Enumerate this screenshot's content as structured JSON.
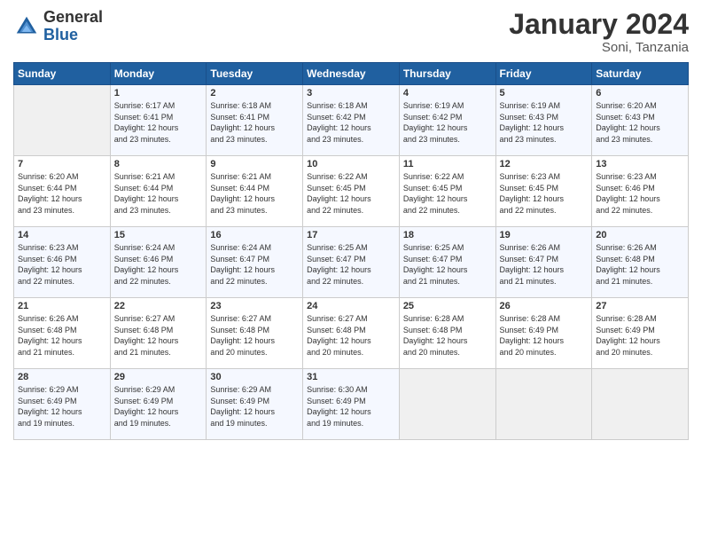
{
  "header": {
    "logo_line1": "General",
    "logo_line2": "Blue",
    "month": "January 2024",
    "location": "Soni, Tanzania"
  },
  "weekdays": [
    "Sunday",
    "Monday",
    "Tuesday",
    "Wednesday",
    "Thursday",
    "Friday",
    "Saturday"
  ],
  "weeks": [
    [
      {
        "day": "",
        "info": ""
      },
      {
        "day": "1",
        "info": "Sunrise: 6:17 AM\nSunset: 6:41 PM\nDaylight: 12 hours\nand 23 minutes."
      },
      {
        "day": "2",
        "info": "Sunrise: 6:18 AM\nSunset: 6:41 PM\nDaylight: 12 hours\nand 23 minutes."
      },
      {
        "day": "3",
        "info": "Sunrise: 6:18 AM\nSunset: 6:42 PM\nDaylight: 12 hours\nand 23 minutes."
      },
      {
        "day": "4",
        "info": "Sunrise: 6:19 AM\nSunset: 6:42 PM\nDaylight: 12 hours\nand 23 minutes."
      },
      {
        "day": "5",
        "info": "Sunrise: 6:19 AM\nSunset: 6:43 PM\nDaylight: 12 hours\nand 23 minutes."
      },
      {
        "day": "6",
        "info": "Sunrise: 6:20 AM\nSunset: 6:43 PM\nDaylight: 12 hours\nand 23 minutes."
      }
    ],
    [
      {
        "day": "7",
        "info": "Sunrise: 6:20 AM\nSunset: 6:44 PM\nDaylight: 12 hours\nand 23 minutes."
      },
      {
        "day": "8",
        "info": "Sunrise: 6:21 AM\nSunset: 6:44 PM\nDaylight: 12 hours\nand 23 minutes."
      },
      {
        "day": "9",
        "info": "Sunrise: 6:21 AM\nSunset: 6:44 PM\nDaylight: 12 hours\nand 23 minutes."
      },
      {
        "day": "10",
        "info": "Sunrise: 6:22 AM\nSunset: 6:45 PM\nDaylight: 12 hours\nand 22 minutes."
      },
      {
        "day": "11",
        "info": "Sunrise: 6:22 AM\nSunset: 6:45 PM\nDaylight: 12 hours\nand 22 minutes."
      },
      {
        "day": "12",
        "info": "Sunrise: 6:23 AM\nSunset: 6:45 PM\nDaylight: 12 hours\nand 22 minutes."
      },
      {
        "day": "13",
        "info": "Sunrise: 6:23 AM\nSunset: 6:46 PM\nDaylight: 12 hours\nand 22 minutes."
      }
    ],
    [
      {
        "day": "14",
        "info": "Sunrise: 6:23 AM\nSunset: 6:46 PM\nDaylight: 12 hours\nand 22 minutes."
      },
      {
        "day": "15",
        "info": "Sunrise: 6:24 AM\nSunset: 6:46 PM\nDaylight: 12 hours\nand 22 minutes."
      },
      {
        "day": "16",
        "info": "Sunrise: 6:24 AM\nSunset: 6:47 PM\nDaylight: 12 hours\nand 22 minutes."
      },
      {
        "day": "17",
        "info": "Sunrise: 6:25 AM\nSunset: 6:47 PM\nDaylight: 12 hours\nand 22 minutes."
      },
      {
        "day": "18",
        "info": "Sunrise: 6:25 AM\nSunset: 6:47 PM\nDaylight: 12 hours\nand 21 minutes."
      },
      {
        "day": "19",
        "info": "Sunrise: 6:26 AM\nSunset: 6:47 PM\nDaylight: 12 hours\nand 21 minutes."
      },
      {
        "day": "20",
        "info": "Sunrise: 6:26 AM\nSunset: 6:48 PM\nDaylight: 12 hours\nand 21 minutes."
      }
    ],
    [
      {
        "day": "21",
        "info": "Sunrise: 6:26 AM\nSunset: 6:48 PM\nDaylight: 12 hours\nand 21 minutes."
      },
      {
        "day": "22",
        "info": "Sunrise: 6:27 AM\nSunset: 6:48 PM\nDaylight: 12 hours\nand 21 minutes."
      },
      {
        "day": "23",
        "info": "Sunrise: 6:27 AM\nSunset: 6:48 PM\nDaylight: 12 hours\nand 20 minutes."
      },
      {
        "day": "24",
        "info": "Sunrise: 6:27 AM\nSunset: 6:48 PM\nDaylight: 12 hours\nand 20 minutes."
      },
      {
        "day": "25",
        "info": "Sunrise: 6:28 AM\nSunset: 6:48 PM\nDaylight: 12 hours\nand 20 minutes."
      },
      {
        "day": "26",
        "info": "Sunrise: 6:28 AM\nSunset: 6:49 PM\nDaylight: 12 hours\nand 20 minutes."
      },
      {
        "day": "27",
        "info": "Sunrise: 6:28 AM\nSunset: 6:49 PM\nDaylight: 12 hours\nand 20 minutes."
      }
    ],
    [
      {
        "day": "28",
        "info": "Sunrise: 6:29 AM\nSunset: 6:49 PM\nDaylight: 12 hours\nand 19 minutes."
      },
      {
        "day": "29",
        "info": "Sunrise: 6:29 AM\nSunset: 6:49 PM\nDaylight: 12 hours\nand 19 minutes."
      },
      {
        "day": "30",
        "info": "Sunrise: 6:29 AM\nSunset: 6:49 PM\nDaylight: 12 hours\nand 19 minutes."
      },
      {
        "day": "31",
        "info": "Sunrise: 6:30 AM\nSunset: 6:49 PM\nDaylight: 12 hours\nand 19 minutes."
      },
      {
        "day": "",
        "info": ""
      },
      {
        "day": "",
        "info": ""
      },
      {
        "day": "",
        "info": ""
      }
    ]
  ]
}
